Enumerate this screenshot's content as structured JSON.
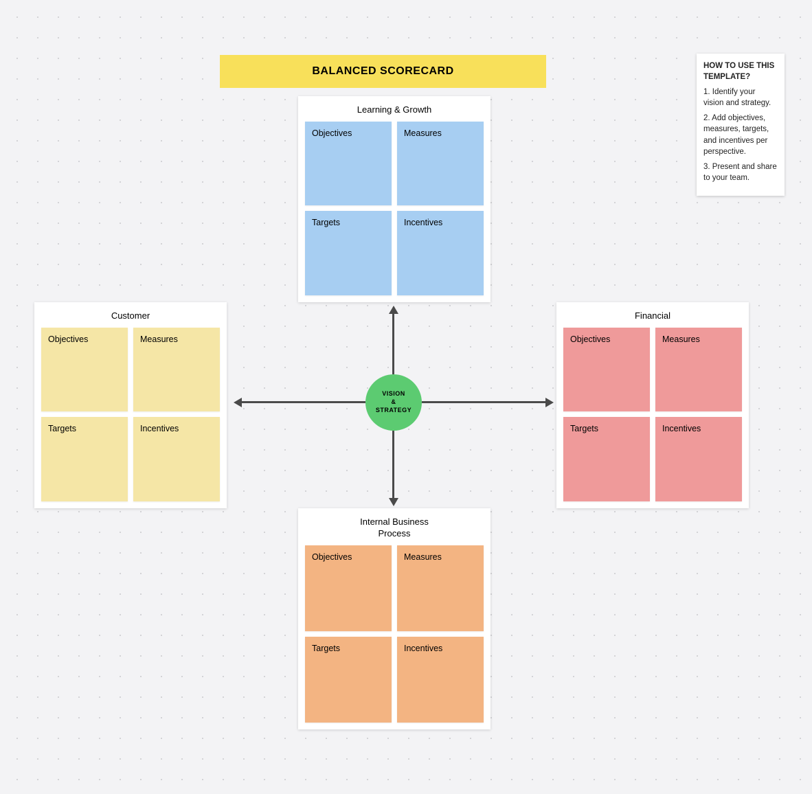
{
  "title": "BALANCED SCORECARD",
  "center": {
    "line1": "VISION",
    "line2": "&",
    "line3": "STRATEGY"
  },
  "help": {
    "title": "HOW TO USE THIS TEMPLATE?",
    "steps": [
      "1. Identify your vision and strategy.",
      "2. Add objectives, measures, targets, and incentives per perspective.",
      "3. Present and share to your team."
    ]
  },
  "panels": {
    "top": {
      "title": "Learning & Growth",
      "cards": [
        "Objectives",
        "Measures",
        "Targets",
        "Incentives"
      ]
    },
    "left": {
      "title": "Customer",
      "cards": [
        "Objectives",
        "Measures",
        "Targets",
        "Incentives"
      ]
    },
    "right": {
      "title": "Financial",
      "cards": [
        "Objectives",
        "Measures",
        "Targets",
        "Incentives"
      ]
    },
    "bottom": {
      "title": "Internal Business Process",
      "cards": [
        "Objectives",
        "Measures",
        "Targets",
        "Incentives"
      ]
    }
  },
  "colors": {
    "title_bg": "#f8e05a",
    "center_bg": "#5ccb71",
    "top_card": "#a7cef2",
    "left_card": "#f5e6a6",
    "right_card": "#ef9a9a",
    "bottom_card": "#f3b482"
  }
}
